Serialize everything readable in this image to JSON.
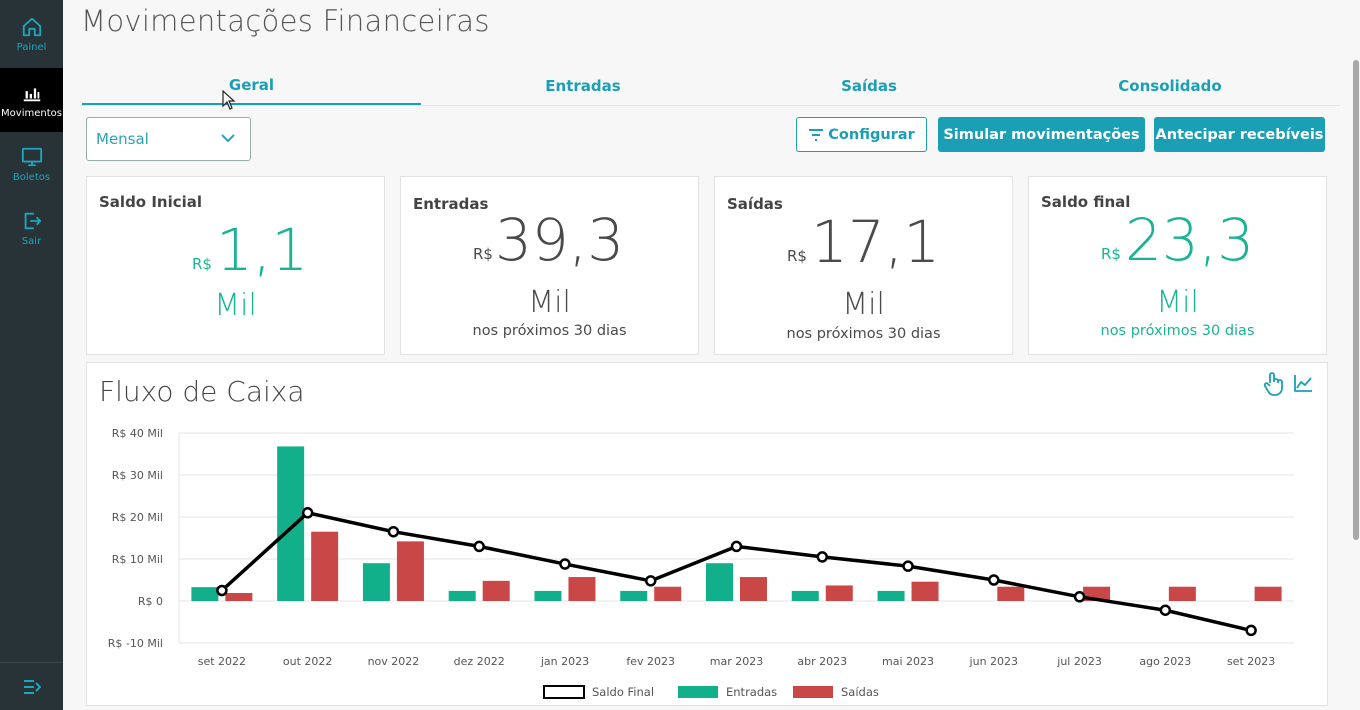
{
  "sidebar": {
    "items": [
      {
        "label": "Painel",
        "icon": "home-icon"
      },
      {
        "label": "Movimentos",
        "icon": "bar-chart-icon"
      },
      {
        "label": "Boletos",
        "icon": "monitor-icon"
      },
      {
        "label": "Sair",
        "icon": "logout-icon"
      }
    ],
    "collapse_icon": "collapse-menu-icon"
  },
  "header": {
    "title": "Movimentações Financeiras"
  },
  "tabs": [
    {
      "label": "Geral",
      "active": true
    },
    {
      "label": "Entradas",
      "active": false
    },
    {
      "label": "Saídas",
      "active": false
    },
    {
      "label": "Consolidado",
      "active": false
    }
  ],
  "controls": {
    "period_value": "Mensal",
    "configure_label": "Configurar",
    "simulate_label": "Simular movimentações",
    "anticipate_label": "Antecipar recebíveis"
  },
  "cards": [
    {
      "title": "Saldo Inicial",
      "currency": "R$",
      "value": "1,1",
      "unit": "Mil",
      "sub": ""
    },
    {
      "title": "Entradas",
      "currency": "R$",
      "value": "39,3",
      "unit": "Mil",
      "sub": "nos próximos 30 dias"
    },
    {
      "title": "Saídas",
      "currency": "R$",
      "value": "17,1",
      "unit": "Mil",
      "sub": "nos próximos 30 dias"
    },
    {
      "title": "Saldo final",
      "currency": "R$",
      "value": "23,3",
      "unit": "Mil",
      "sub": "nos próximos 30 dias"
    }
  ],
  "colors": {
    "accent": "#1a9fb5",
    "entradas": "#12b08a",
    "saidas": "#c94747",
    "saldo": "#000000",
    "sidebar": "#283338"
  },
  "chart_data": {
    "type": "bar",
    "title": "Fluxo de Caixa",
    "categories": [
      "set 2022",
      "out 2022",
      "nov 2022",
      "dez 2022",
      "jan 2023",
      "fev 2023",
      "mar 2023",
      "abr 2023",
      "mai 2023",
      "jun 2023",
      "jul 2023",
      "ago 2023",
      "set 2023"
    ],
    "y_ticks": [
      "R$ 40 Mil",
      "R$ 30 Mil",
      "R$ 20 Mil",
      "R$ 10 Mil",
      "R$ 0",
      "R$ -10 Mil"
    ],
    "ylim": [
      -10,
      40
    ],
    "series": [
      {
        "name": "Saldo Final",
        "kind": "line",
        "values": [
          2.5,
          21,
          16.5,
          13,
          8.8,
          4.8,
          13,
          10.5,
          8.3,
          5,
          1,
          -2.2,
          -7
        ]
      },
      {
        "name": "Entradas",
        "kind": "bar",
        "values": [
          3.3,
          36.8,
          9,
          2.4,
          2.4,
          2.4,
          9,
          2.4,
          2.4,
          0,
          0,
          0,
          0
        ]
      },
      {
        "name": "Saídas",
        "kind": "bar",
        "values": [
          1.9,
          16.5,
          14.2,
          4.8,
          5.7,
          3.4,
          5.7,
          3.7,
          4.6,
          3.4,
          3.4,
          3.4,
          3.4
        ]
      }
    ],
    "grid": true,
    "legend_position": "bottom"
  }
}
